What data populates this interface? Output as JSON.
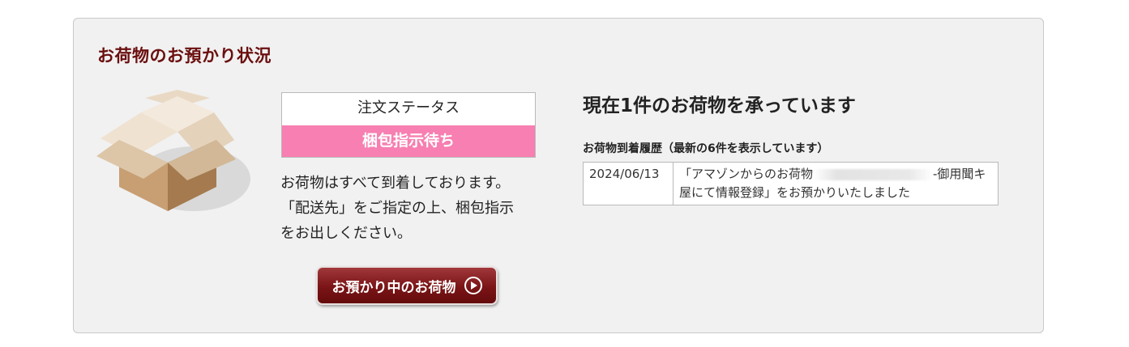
{
  "panel": {
    "title": "お荷物のお預かり状況"
  },
  "status": {
    "label": "注文ステータス",
    "value": "梱包指示待ち",
    "highlight_color": "#f77fb1"
  },
  "description": {
    "lines": [
      "お荷物はすべて到着しております。",
      "「配送先」をご指定の上、梱包指示",
      "をお出しください。"
    ]
  },
  "button": {
    "label": "お預かり中のお荷物",
    "icon": "play-circle-icon",
    "color": "#7a1416"
  },
  "summary": {
    "text": "現在1件のお荷物を承っています"
  },
  "history": {
    "title": "お荷物到着履歴（最新の6件を表示しています）",
    "rows": [
      {
        "date": "2024/06/13",
        "message_before": "「アマゾンからのお荷物",
        "message_after": "-御用聞キ屋にて情報登録」をお預かりいたしました"
      }
    ]
  },
  "illustration": {
    "icon": "open-cardboard-box-icon"
  }
}
